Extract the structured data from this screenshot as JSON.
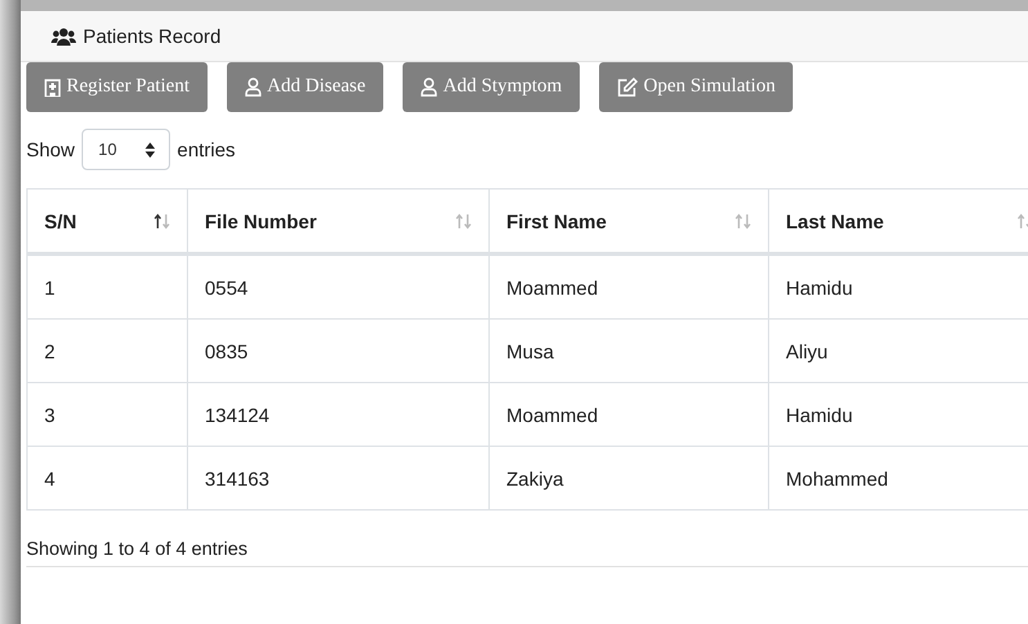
{
  "card": {
    "title": "Patients Record"
  },
  "buttons": [
    {
      "label": "Register Patient",
      "kind": "hospital"
    },
    {
      "label": "Add Disease",
      "kind": "user"
    },
    {
      "label": "Add Stymptom",
      "kind": "user"
    },
    {
      "label": "Open Simulation",
      "kind": "edit"
    }
  ],
  "length": {
    "before": "Show",
    "value": "10",
    "after": "entries"
  },
  "table": {
    "columns": [
      {
        "label": "S/N",
        "sorted": true
      },
      {
        "label": "File Number",
        "sorted": false
      },
      {
        "label": "First Name",
        "sorted": false
      },
      {
        "label": "Last Name",
        "sorted": false
      }
    ],
    "rows": [
      [
        "1",
        "0554",
        "Moammed",
        "Hamidu"
      ],
      [
        "2",
        "0835",
        "Musa",
        "Aliyu"
      ],
      [
        "3",
        "134124",
        "Moammed",
        "Hamidu"
      ],
      [
        "4",
        "314163",
        "Zakiya",
        "Mohammed"
      ]
    ]
  },
  "info": "Showing 1 to 4 of 4 entries"
}
